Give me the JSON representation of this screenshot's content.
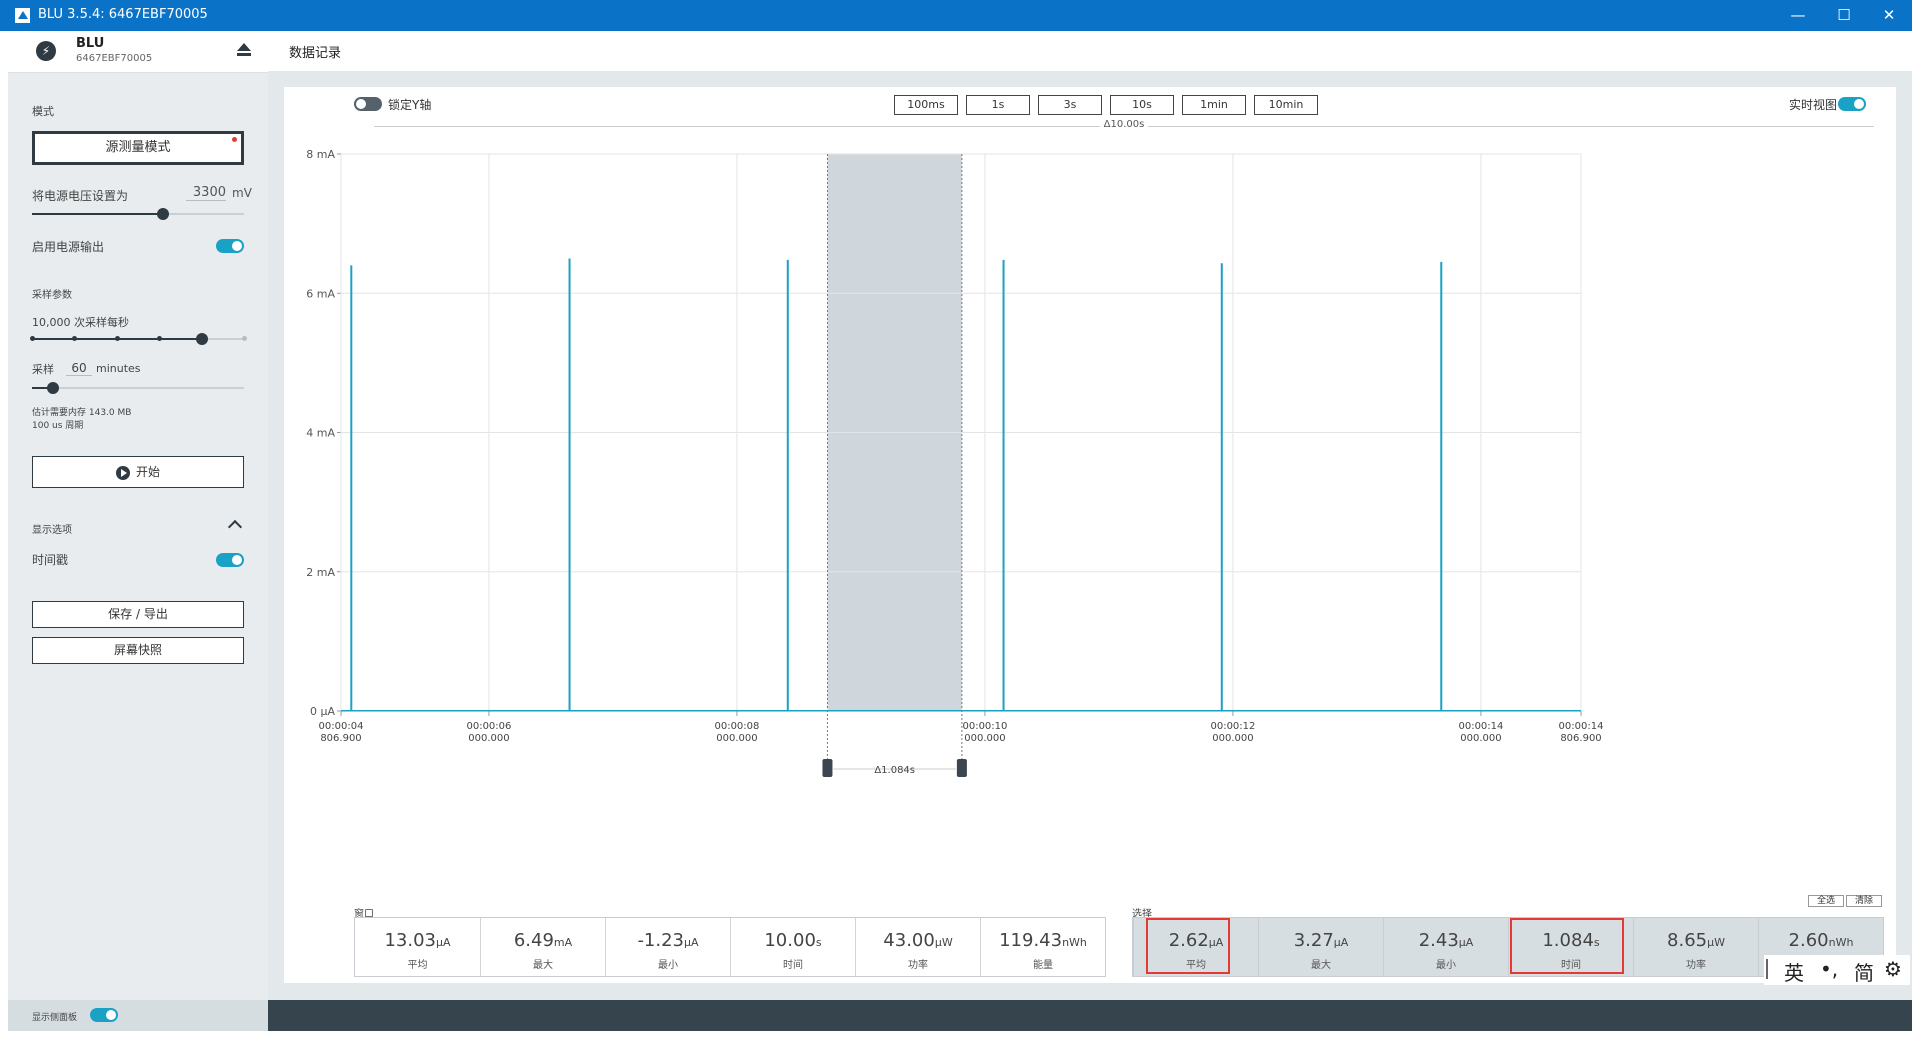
{
  "window": {
    "title": "BLU 3.5.4: 6467EBF70005"
  },
  "device": {
    "name": "BLU",
    "serial": "6467EBF70005"
  },
  "sidebar": {
    "mode_label": "模式",
    "mode_button": "源测量模式",
    "voltage_label": "将电源电压设置为",
    "voltage_value": "3300",
    "voltage_unit": "mV",
    "voltage_slider_fraction": 0.62,
    "power_output_label": "启用电源输出",
    "power_output_on": true,
    "sampling_label": "采样参数",
    "rate_label": "10,000 次采样每秒",
    "rate_step_index": 4,
    "rate_steps": 6,
    "duration_prefix": "采样",
    "duration_value": "60",
    "duration_unit": "minutes",
    "duration_slider_fraction": 0.1,
    "memory_estimate": "估计需要内存 143.0 MB",
    "period": "100 us 周期",
    "start_button": "开始",
    "display_options_label": "显示选项",
    "timestamp_label": "时间戳",
    "timestamp_on": true,
    "save_export_button": "保存 / 导出",
    "screenshot_button": "屏幕快照",
    "show_side_panel_label": "显示侧面板",
    "show_side_panel_on": true
  },
  "main": {
    "title": "数据记录",
    "lock_y_label": "锁定Y轴",
    "lock_y_on": false,
    "zoom_buttons": [
      "100ms",
      "1s",
      "3s",
      "10s",
      "1min",
      "10min"
    ],
    "live_view_label": "实时视图",
    "live_view_on": true,
    "window_delta": "Δ10.00s",
    "selection_delta": "Δ1.084s",
    "window_stats_label": "窗口",
    "selection_stats_label": "选择",
    "select_all_button": "全选",
    "clear_button": "清除",
    "window_stats": [
      {
        "value": "13.03",
        "unit": "μA",
        "label": "平均"
      },
      {
        "value": "6.49",
        "unit": "mA",
        "label": "最大"
      },
      {
        "value": "-1.23",
        "unit": "μA",
        "label": "最小"
      },
      {
        "value": "10.00",
        "unit": "s",
        "label": "时间"
      },
      {
        "value": "43.00",
        "unit": "μW",
        "label": "功率"
      },
      {
        "value": "119.43",
        "unit": "nWh",
        "label": "能量"
      }
    ],
    "selection_stats": [
      {
        "value": "2.62",
        "unit": "μA",
        "label": "平均"
      },
      {
        "value": "3.27",
        "unit": "μA",
        "label": "最大"
      },
      {
        "value": "2.43",
        "unit": "μA",
        "label": "最小"
      },
      {
        "value": "1.084",
        "unit": "s",
        "label": "时间"
      },
      {
        "value": "8.65",
        "unit": "μW",
        "label": "功率"
      },
      {
        "value": "2.60",
        "unit": "nWh",
        "label": "能量"
      }
    ]
  },
  "chart_data": {
    "type": "line",
    "y_unit": "mA",
    "ylim": [
      0,
      8
    ],
    "y_ticks": [
      {
        "value": 0,
        "label": "0 μA"
      },
      {
        "value": 2,
        "label": "2 mA"
      },
      {
        "value": 4,
        "label": "4 mA"
      },
      {
        "value": 6,
        "label": "6 mA"
      },
      {
        "value": 8,
        "label": "8 mA"
      }
    ],
    "xlim": [
      4.8069,
      14.8069
    ],
    "x_ticks": [
      {
        "value": 4.8069,
        "label1": "00:00:04",
        "label2": "806.900"
      },
      {
        "value": 6.0,
        "label1": "00:00:06",
        "label2": "000.000"
      },
      {
        "value": 8.0,
        "label1": "00:00:08",
        "label2": "000.000"
      },
      {
        "value": 10.0,
        "label1": "00:00:10",
        "label2": "000.000"
      },
      {
        "value": 12.0,
        "label1": "00:00:12",
        "label2": "000.000"
      },
      {
        "value": 14.0,
        "label1": "00:00:14",
        "label2": "000.000"
      },
      {
        "value": 14.8069,
        "label1": "00:00:14",
        "label2": "806.900"
      }
    ],
    "color": "#1aa2c6",
    "baseline": 0.003,
    "spikes": [
      {
        "x": 4.89,
        "peak": 6.4
      },
      {
        "x": 6.65,
        "peak": 6.5
      },
      {
        "x": 8.41,
        "peak": 6.48
      },
      {
        "x": 10.15,
        "peak": 6.48
      },
      {
        "x": 11.91,
        "peak": 6.43
      },
      {
        "x": 13.68,
        "peak": 6.45
      }
    ],
    "selection": [
      8.73,
      9.814
    ]
  },
  "ime": {
    "lang": "英",
    "punct": "•,",
    "mode": "简"
  }
}
